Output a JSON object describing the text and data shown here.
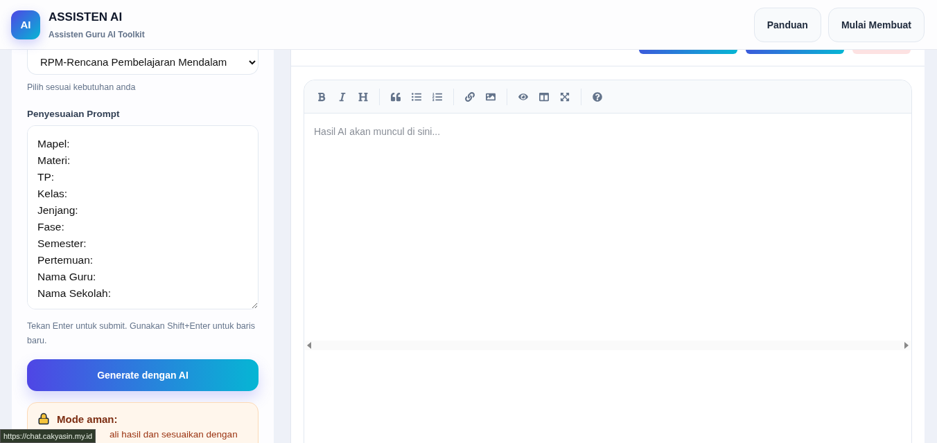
{
  "header": {
    "logo": "AI",
    "title": "ASSISTEN AI",
    "subtitle": "Assisten Guru AI Toolkit",
    "buttons": [
      "Panduan",
      "Mulai Membuat"
    ]
  },
  "sidebar": {
    "template_select": {
      "value": "RPM-Rencana Pembelajaran Mendalam"
    },
    "select_hint": "Pilih sesuai kebutuhan anda",
    "prompt_label": "Penyesuaian Prompt",
    "prompt_lines": [
      "Mapel:",
      "Materi:",
      "TP:",
      "Kelas:",
      "Jenjang:",
      "Fase:",
      "Semester:",
      "Pertemuan:",
      "Nama Guru:",
      "Nama Sekolah:"
    ],
    "prompt_hint": "Tekan Enter untuk submit. Gunakan Shift+Enter untuk baris baru.",
    "generate_button": "Generate dengan AI",
    "notice": {
      "title": "Mode aman:",
      "text": "ali hasil dan sesuaikan dengan"
    }
  },
  "editor": {
    "top_buttons": [
      {
        "kind": "gradient"
      },
      {
        "kind": "gradient"
      },
      {
        "kind": "danger"
      }
    ],
    "placeholder": "Hasil AI akan muncul di sini..."
  },
  "status_url": "https://chat.cakyasin.my.id"
}
